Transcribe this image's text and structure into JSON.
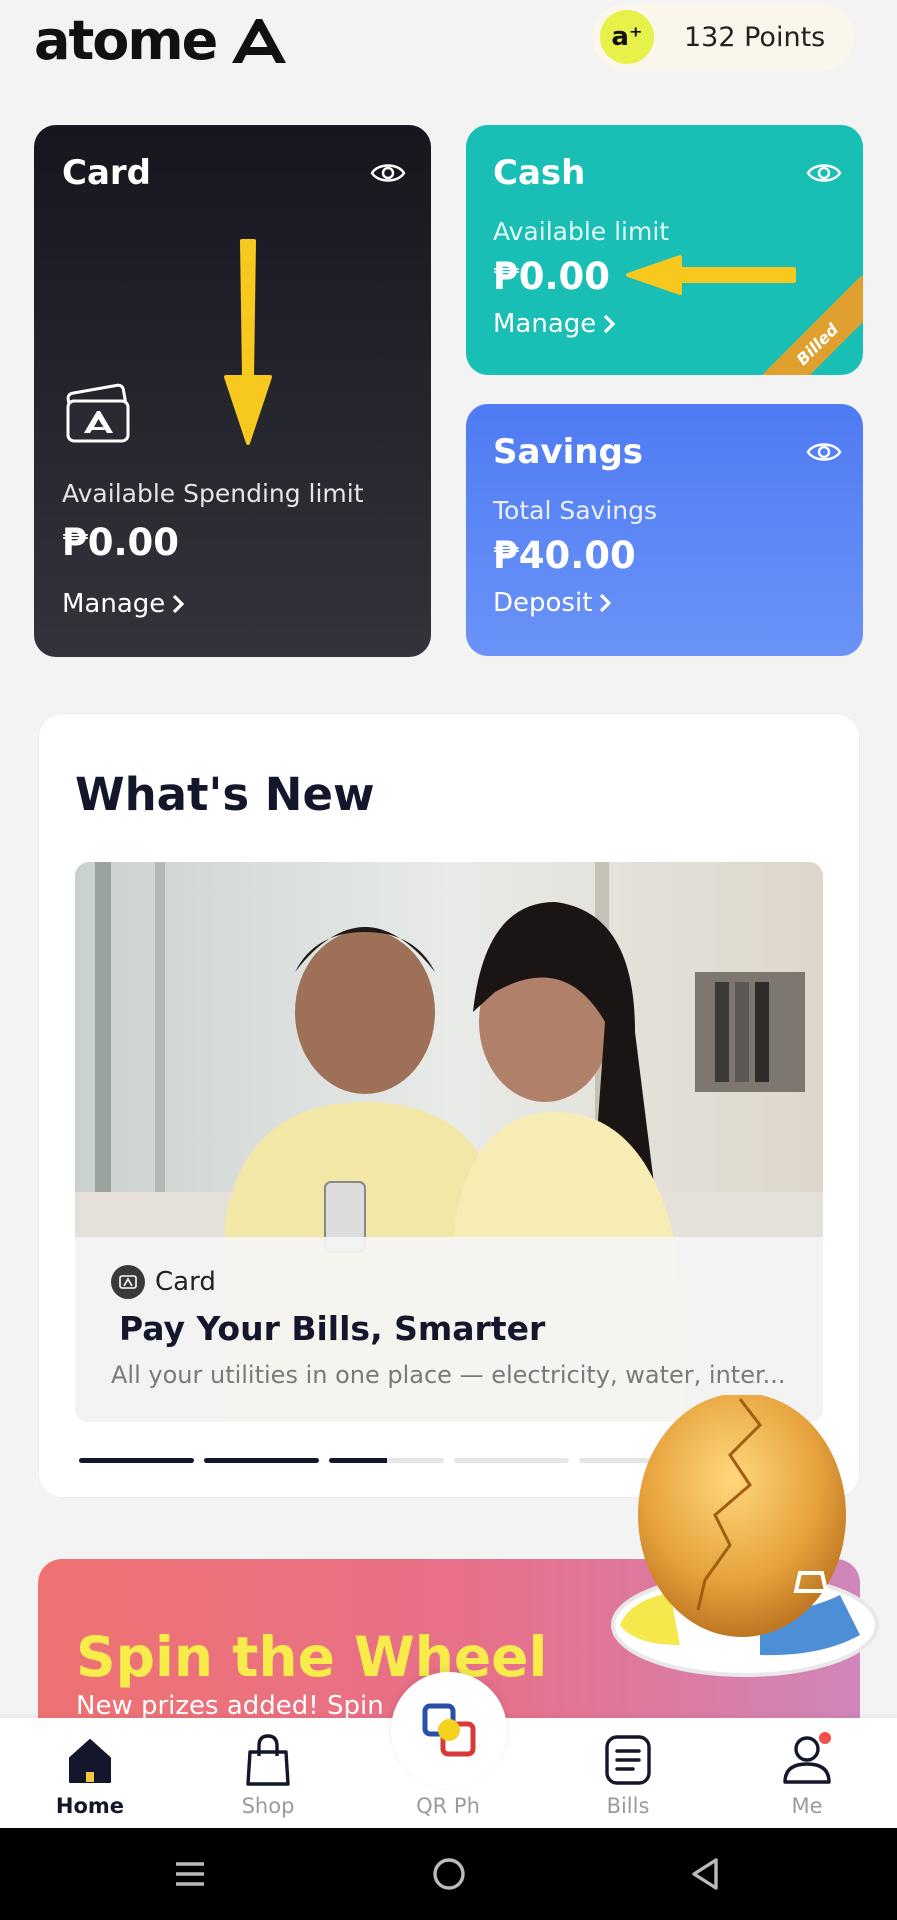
{
  "header": {
    "logo_text": "atome",
    "points_badge": "a⁺",
    "points_label": "132 Points"
  },
  "cards": {
    "card": {
      "title": "Card",
      "subtitle": "Available Spending limit",
      "amount": "₱0.00",
      "link": "Manage"
    },
    "cash": {
      "title": "Cash",
      "subtitle": "Available limit",
      "amount": "₱0.00",
      "link": "Manage",
      "ribbon": "Billed"
    },
    "savings": {
      "title": "Savings",
      "subtitle": "Total Savings",
      "amount": "₱40.00",
      "link": "Deposit"
    }
  },
  "whats_new": {
    "title": "What's New",
    "promo": {
      "category": "Card",
      "title": "Pay Your Bills, Smarter",
      "description": "All your utilities in one place — electricity, water, inter..."
    },
    "carousel_progress": [
      1,
      1,
      0.5,
      0,
      0
    ]
  },
  "spin": {
    "title": "Spin the Wheel",
    "subtitle": "New prizes added! Spin"
  },
  "nav": {
    "items": [
      {
        "label": "Home",
        "icon": "home-icon"
      },
      {
        "label": "Shop",
        "icon": "shopping-bag-icon"
      },
      {
        "label": "QR Ph",
        "icon": "qr-scan-icon"
      },
      {
        "label": "Bills",
        "icon": "bills-icon"
      },
      {
        "label": "Me",
        "icon": "profile-icon"
      }
    ],
    "active": "Home"
  },
  "colors": {
    "cash_card": "#19bfb5",
    "savings_card": "#5a85f5",
    "accent_yellow": "#f7ec4a",
    "ribbon": "#e0a030",
    "annotation_arrow": "#f7c81e"
  }
}
